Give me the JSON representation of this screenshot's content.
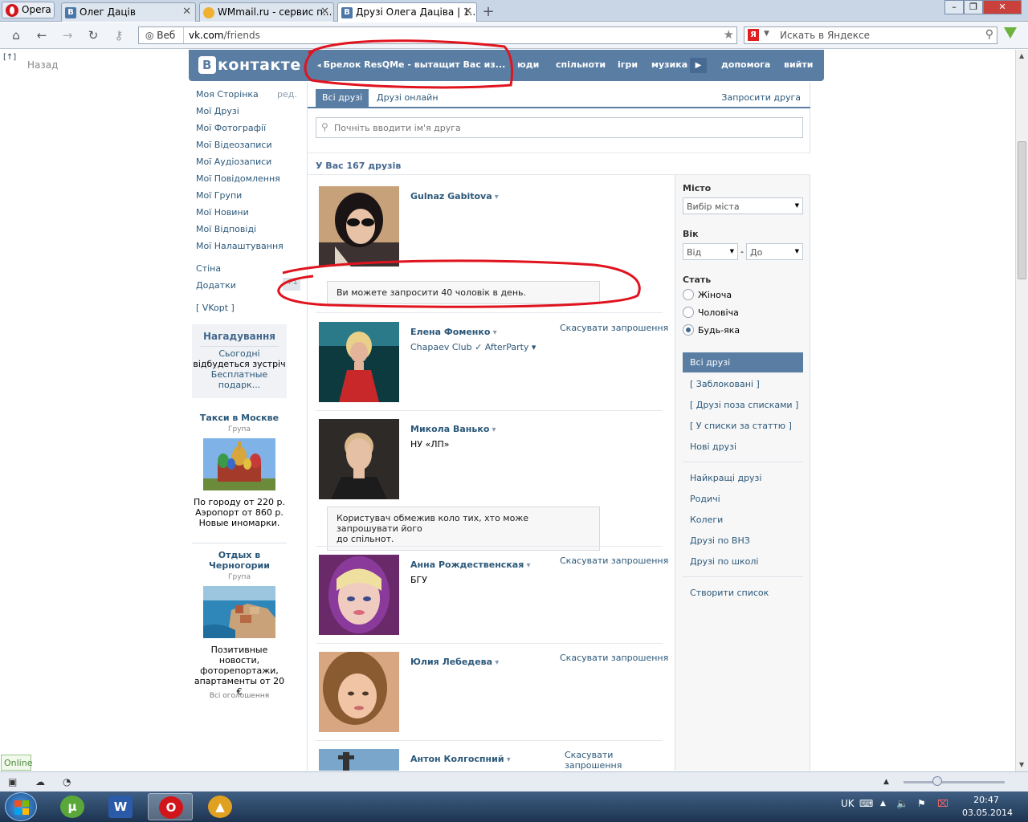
{
  "browser": {
    "menu_label": "Opera",
    "tabs": [
      {
        "label": "Олег Даців",
        "icon": "vk-favicon"
      },
      {
        "label": "WMmail.ru - сервис п...",
        "icon": "wmmail-favicon"
      },
      {
        "label": "Друзі Олега Дацiва | 1...",
        "icon": "vk-favicon"
      }
    ],
    "address_prefix": "Веб",
    "url_host": "vk.com",
    "url_path": "/friends",
    "search_placeholder": "Искать в Яндексе",
    "yandex_letter": "Я",
    "back_label": "Назад",
    "back_icon_text": "[↑]"
  },
  "vk": {
    "logo_letter": "В",
    "logo_text": "контакте",
    "ad_text": "Брелок ResQMe - вытащит Вас из...",
    "nav": [
      "люди",
      "спільноти",
      "ігри",
      "музика",
      "допомога",
      "вийти"
    ],
    "nav_people_visible": "юди"
  },
  "sidebar": {
    "items": [
      "Моя Сторінка",
      "Мої Друзі",
      "Мої Фотографії",
      "Мої Відеозаписи",
      "Мої Аудіозаписи",
      "Мої Повідомлення",
      "Мої Групи",
      "Мої Новини",
      "Мої Відповіді",
      "Мої Налаштування"
    ],
    "edit": "ред.",
    "items2": [
      "Стіна",
      "Додатки"
    ],
    "apps_badge": "+1",
    "vkopt": "[ VKopt ]",
    "reminder": {
      "title": "Нагадування",
      "line1": "Сьогодні",
      "line2": "відбудеться зустріч",
      "line3": "Бесплатные",
      "line4": "подарк..."
    },
    "ads": [
      {
        "title": "Такси в Москве",
        "type": "Група",
        "desc": [
          "По городу от 220 р.",
          "Аэропорт от 860 р.",
          "Новые иномарки."
        ]
      },
      {
        "title": "Отдых в Черногории",
        "type": "Група",
        "desc": [
          "Позитивные новости,",
          "фоторепортажи,",
          "апартаменты от 20 €"
        ]
      }
    ],
    "all_ads": "Всі оголошення"
  },
  "main": {
    "tab_all": "Всі друзі",
    "tab_online": "Друзі онлайн",
    "invite": "Запросити друга",
    "search_placeholder": "Почніть вводити ім'я друга",
    "count": "У Вас 167 друзів",
    "cancel_label": "Скасувати запрошення",
    "cancel_split": [
      "Скасувати",
      "запрошення"
    ],
    "friends": [
      {
        "name": "Gulnaz Gabitova",
        "info": "",
        "cancel": false
      },
      {
        "name": "Елена Фоменко",
        "info": "Chapaev Club ✓ AfterParty ▾",
        "cancel": true
      },
      {
        "name": "Микола Ванько",
        "info": "НУ «ЛП»",
        "cancel": false
      },
      {
        "name": "Анна Рождественская",
        "info": "БГУ",
        "cancel": true
      },
      {
        "name": "Юлия Лебедева",
        "info": "",
        "cancel": true
      },
      {
        "name": "Антон Колгоспний",
        "info": "",
        "cancel": true
      }
    ],
    "notice1": "Ви можете запросити 40 чоловік в день.",
    "notice2_line1": "Користувач обмежив коло тих, хто може запрошувати його",
    "notice2_line2": "до спільнот."
  },
  "filters": {
    "city_label": "Місто",
    "city_value": "Вибір міста",
    "age_label": "Вік",
    "age_from": "Від",
    "age_dash": "-",
    "age_to": "До",
    "sex_label": "Стать",
    "sex_options": [
      "Жіноча",
      "Чоловіча",
      "Будь-яка"
    ],
    "sex_selected": "Будь-яка",
    "lists": [
      "Всі друзі",
      "[ Заблоковані ]",
      "[ Друзі поза списками ]",
      "[ У списки за статтю ]",
      "Нові друзі"
    ],
    "lists2": [
      "Найкращі друзі",
      "Родичі",
      "Колеги",
      "Друзі по ВНЗ",
      "Друзі по школі"
    ],
    "create_list": "Створити список"
  },
  "status": {
    "online": "Online"
  },
  "taskbar": {
    "lang": "UK",
    "time": "20:47",
    "date": "03.05.2014",
    "word_letter": "W"
  },
  "colors": {
    "vk_blue": "#597da3",
    "link": "#2b587a",
    "annotation_red": "#e0141e"
  }
}
